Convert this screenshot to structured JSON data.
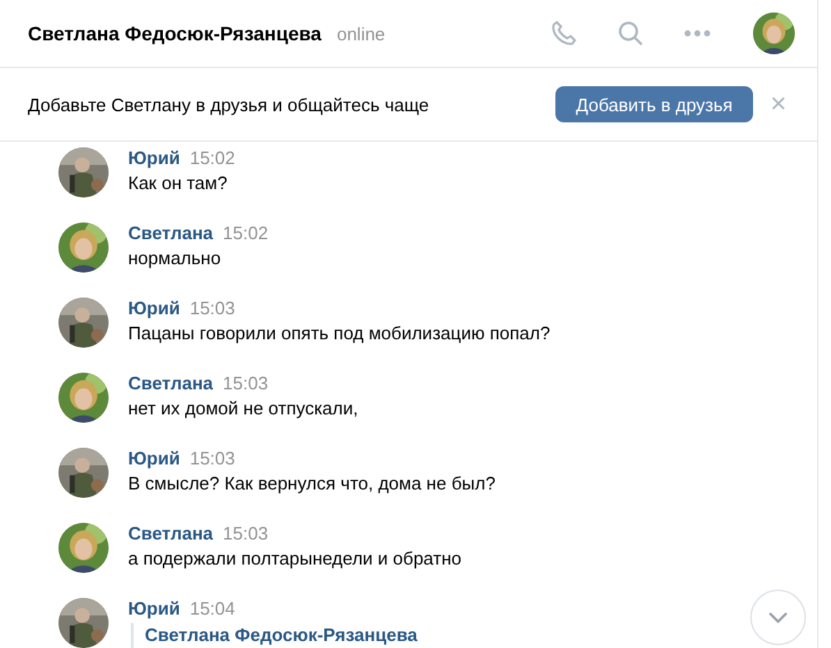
{
  "header": {
    "title": "Светлана Федосюк-Рязанцева",
    "status": "online"
  },
  "banner": {
    "text": "Добавьте Светлану в друзья и общайтесь чаще",
    "button": "Добавить в друзья",
    "close": "×"
  },
  "messages": [
    {
      "author": "Юрий",
      "time": "15:02",
      "text": "Как он там?"
    },
    {
      "author": "Светлана",
      "time": "15:02",
      "text": "нормально"
    },
    {
      "author": "Юрий",
      "time": "15:03",
      "text": "Пацаны говорили опять под мобилизацию попал?"
    },
    {
      "author": "Светлана",
      "time": "15:03",
      "text": "нет их домой не отпускали,"
    },
    {
      "author": "Юрий",
      "time": "15:03",
      "text": "В смысле? Как вернулся что, дома не был?"
    },
    {
      "author": "Светлана",
      "time": "15:03",
      "text": "а подержали полтарынедели и обратно"
    },
    {
      "author": "Юрий",
      "time": "15:04",
      "quote": "Светлана Федосюк-Рязанцева"
    }
  ]
}
